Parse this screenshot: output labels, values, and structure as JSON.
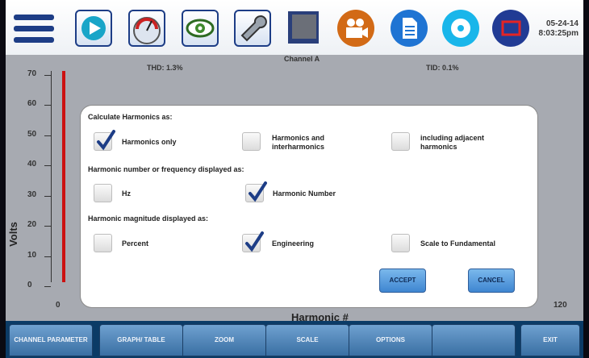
{
  "datetime": {
    "date": "05-24-14",
    "time": "8:03:25pm"
  },
  "toolbar": {
    "icons": [
      "menu-icon",
      "play-icon",
      "gauge-icon",
      "eye-icon",
      "wrench-icon",
      "display-icon",
      "video-camera-icon",
      "document-icon",
      "disc-icon",
      "stop-icon"
    ]
  },
  "chart": {
    "channel": "Channel A",
    "thd": "THD: 1.3%",
    "tid": "TID: 0.1%",
    "ylabel": "Volts",
    "xlabel": "Harmonic #",
    "yticks": [
      "70",
      "60",
      "50",
      "40",
      "30",
      "20",
      "10",
      "0"
    ],
    "xticks": [
      "0",
      "120"
    ]
  },
  "chart_data": {
    "type": "bar",
    "title": "Channel A",
    "xlabel": "Harmonic #",
    "ylabel": "Volts",
    "x": [
      1
    ],
    "values": [
      70
    ],
    "xlim": [
      0,
      120
    ],
    "ylim": [
      0,
      70
    ]
  },
  "dialog": {
    "section1": "Calculate Harmonics as:",
    "opt_harmonics_only": "Harmonics only",
    "opt_harm_inter": "Harmonics and interharmonics",
    "opt_adjacent": "including adjacent harmonics",
    "section2": "Harmonic number or frequency displayed as:",
    "opt_hz": "Hz",
    "opt_harmonic_number": "Harmonic Number",
    "section3": "Harmonic magnitude displayed as:",
    "opt_percent": "Percent",
    "opt_engineering": "Engineering",
    "opt_scale_fund": "Scale to Fundamental",
    "accept": "ACCEPT",
    "cancel": "CANCEL",
    "checked": {
      "harmonics_only": true,
      "harm_inter": false,
      "adjacent": false,
      "hz": false,
      "harmonic_number": true,
      "percent": false,
      "engineering": true,
      "scale_fund": false
    }
  },
  "bottombar": {
    "channel_parameter": "CHANNEL PARAMETER",
    "graph_table": "GRAPH/ TABLE",
    "zoom": "ZOOM",
    "scale": "SCALE",
    "options": "OPTIONS",
    "blank": "",
    "exit": "EXIT"
  },
  "colors": {
    "accent": "#1d3d86",
    "bar": "#cc1111",
    "button": "#3f86d1",
    "bottom_bar": "#0b3b66"
  }
}
